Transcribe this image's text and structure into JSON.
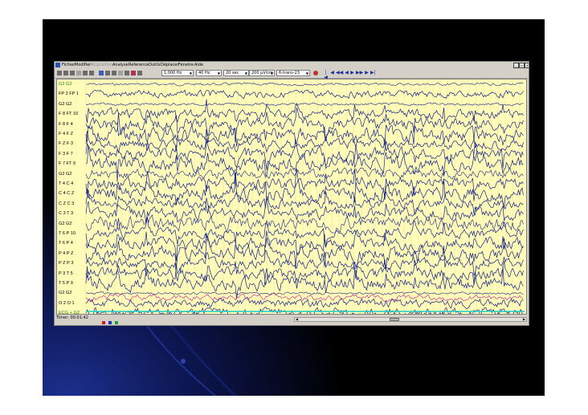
{
  "menu": {
    "items": [
      "Fichier",
      "Modifier",
      "Acquisition",
      "Analyse",
      "Reference",
      "Outils",
      "Déplacer",
      "Fenetre",
      "Aide"
    ],
    "disabled_index": 2
  },
  "window_controls": [
    "_",
    "▫",
    "x"
  ],
  "toolbar": {
    "filter_low": "1,000 Hz",
    "filter_high": "40 Hz",
    "time_base": "20 sec",
    "gain": "200 µV/cm",
    "montage": "6-trans-23",
    "nav_icons": [
      "first-icon",
      "prev-page-icon",
      "rewind-icon",
      "back-icon",
      "play-icon",
      "fast-forward-icon",
      "next-page-icon",
      "last-icon"
    ]
  },
  "channels": [
    {
      "label": "G2 G2",
      "color": "#2a7d00"
    },
    {
      "label": "FP 2 FP 1",
      "color": "#000000"
    },
    {
      "label": "G2 G2",
      "color": "#000000"
    },
    {
      "label": "F 8 FT 10",
      "color": "#000000"
    },
    {
      "label": "F 8 F 4",
      "color": "#000000"
    },
    {
      "label": "F 4 F Z",
      "color": "#000000"
    },
    {
      "label": "F Z F 3",
      "color": "#000000"
    },
    {
      "label": "F 3 F 7",
      "color": "#000000"
    },
    {
      "label": "F 7 FT 9",
      "color": "#000000"
    },
    {
      "label": "G2 G2",
      "color": "#000000"
    },
    {
      "label": "T 4 C 4",
      "color": "#000000"
    },
    {
      "label": "C 4 C Z",
      "color": "#000000"
    },
    {
      "label": "C Z C 3",
      "color": "#000000"
    },
    {
      "label": "C 3 T 3",
      "color": "#000000"
    },
    {
      "label": "G2 G2",
      "color": "#000000"
    },
    {
      "label": "T 6 P 10",
      "color": "#000000"
    },
    {
      "label": "T 6 P 4",
      "color": "#000000"
    },
    {
      "label": "P 4 P Z",
      "color": "#000000"
    },
    {
      "label": "P Z P 3",
      "color": "#000000"
    },
    {
      "label": "P 3 T 5",
      "color": "#000000"
    },
    {
      "label": "T 5 P 9",
      "color": "#000000"
    },
    {
      "label": "G2 G2",
      "color": "#000000"
    },
    {
      "label": "O 2 O 1",
      "color": "#000000"
    },
    {
      "label": "ECG + G2",
      "color": "#2a7d00"
    }
  ],
  "status": {
    "timer": "Timer: 00:01:42"
  },
  "colors": {
    "trace": "#16238a",
    "trace_secondary": "#c2189a",
    "eeg_background": "#fffbb8",
    "baseline": "#1bd0c8",
    "slide_background": "#000000",
    "slide_glow": "#1c2f8e"
  }
}
